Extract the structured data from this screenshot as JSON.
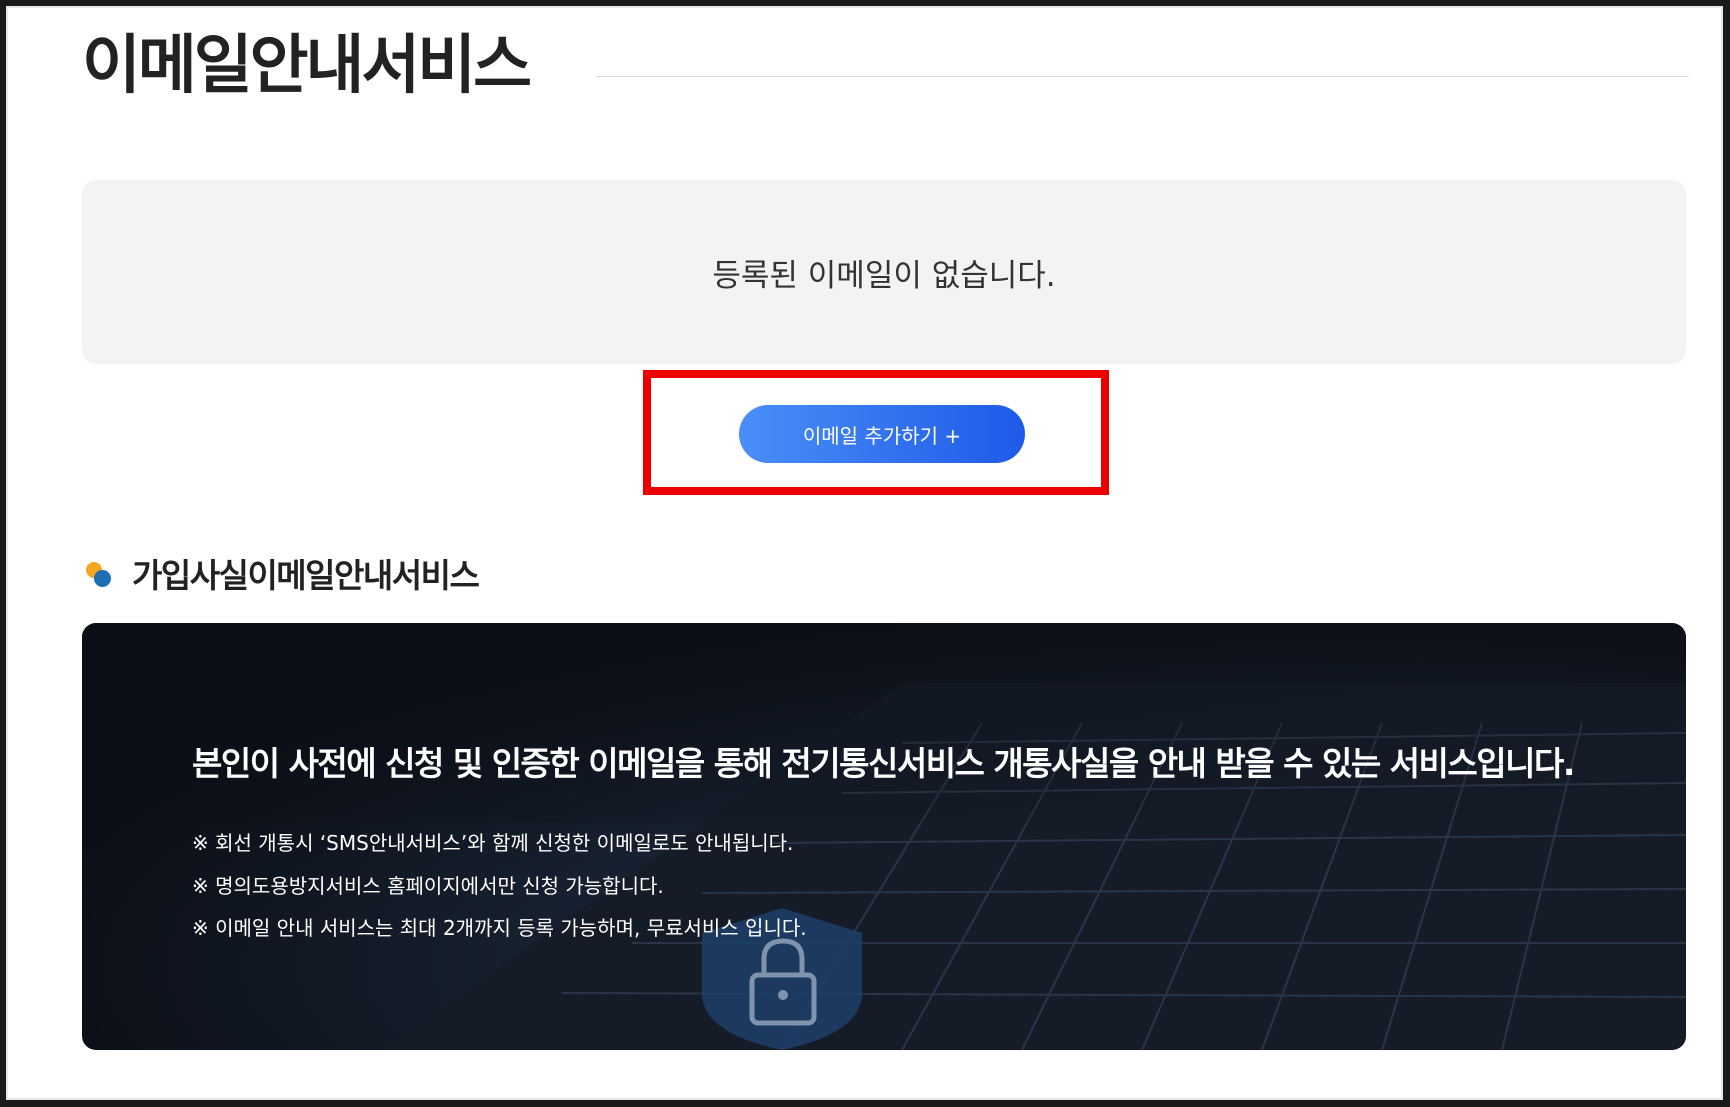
{
  "page": {
    "title": "이메일안내서비스"
  },
  "empty_state": {
    "message": "등록된 이메일이 없습니다."
  },
  "actions": {
    "add_email_label": "이메일 추가하기 +"
  },
  "section": {
    "title": "가입사실이메일안내서비스"
  },
  "banner": {
    "heading": "본인이 사전에 신청 및 인증한 이메일을 통해 전기통신서비스 개통사실을 안내 받을 수 있는 서비스입니다.",
    "notes": [
      "※ 회선 개통시 ‘SMS안내서비스’와 함께 신청한 이메일로도 안내됩니다.",
      "※ 명의도용방지서비스 홈페이지에서만 신청 가능합니다.",
      "※ 이메일 안내 서비스는 최대 2개까지 등록 가능하며, 무료서비스 입니다."
    ]
  },
  "colors": {
    "button_start": "#4a8ff8",
    "button_end": "#1e5ae8",
    "highlight": "#ee0000",
    "bullet_yellow": "#f5a623",
    "bullet_blue": "#1c6fb3"
  }
}
